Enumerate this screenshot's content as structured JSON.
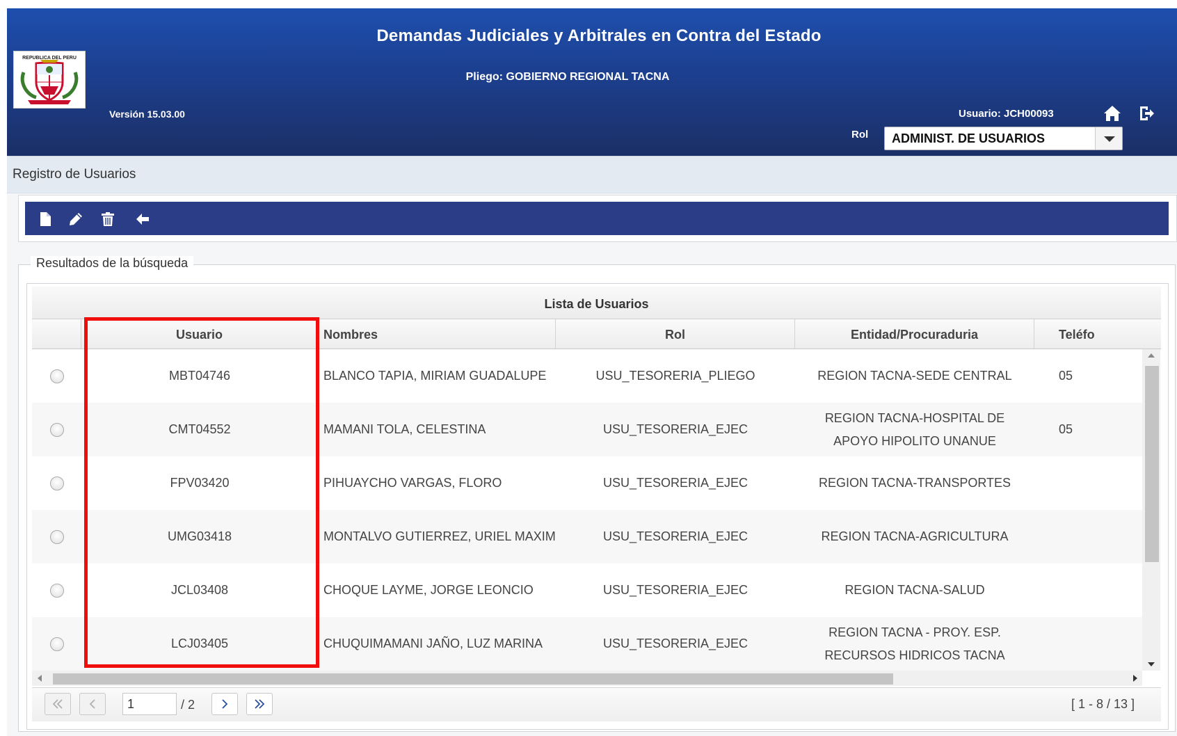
{
  "header": {
    "title": "Demandas Judiciales y Arbitrales en Contra del Estado",
    "pliego": "Pliego: GOBIERNO REGIONAL TACNA",
    "version": "Versión 15.03.00",
    "usuario": "Usuario: JCH00093",
    "rol_label": "Rol",
    "rol_value": "ADMINIST. DE USUARIOS",
    "crest_text": "REPUBLICA DEL PERU",
    "icons": [
      "home-icon",
      "exit-icon"
    ]
  },
  "page": {
    "title": "Registro de Usuarios"
  },
  "toolbar": {
    "icons": [
      "new-document-icon",
      "edit-pencil-icon",
      "delete-trash-icon",
      "back-arrow-icon"
    ]
  },
  "results": {
    "legend": "Resultados de la búsqueda",
    "caption": "Lista de Usuarios",
    "columns": {
      "usuario": "Usuario",
      "nombres": "Nombres",
      "rol": "Rol",
      "entidad": "Entidad/Procuraduria",
      "telefono": "Teléfo"
    },
    "rows": [
      {
        "usuario": "MBT04746",
        "nombres": "BLANCO TAPIA, MIRIAM GUADALUPE",
        "rol": "USU_TESORERIA_PLIEGO",
        "entidad": "REGION TACNA-SEDE CENTRAL",
        "telefono": "05"
      },
      {
        "usuario": "CMT04552",
        "nombres": "MAMANI TOLA, CELESTINA",
        "rol": "USU_TESORERIA_EJEC",
        "entidad": "REGION TACNA-HOSPITAL DE APOYO HIPOLITO UNANUE",
        "telefono": "05"
      },
      {
        "usuario": "FPV03420",
        "nombres": "PIHUAYCHO VARGAS, FLORO",
        "rol": "USU_TESORERIA_EJEC",
        "entidad": "REGION TACNA-TRANSPORTES",
        "telefono": ""
      },
      {
        "usuario": "UMG03418",
        "nombres": "MONTALVO GUTIERREZ, URIEL MAXIMO",
        "rol": "USU_TESORERIA_EJEC",
        "entidad": "REGION TACNA-AGRICULTURA",
        "telefono": ""
      },
      {
        "usuario": "JCL03408",
        "nombres": "CHOQUE LAYME, JORGE LEONCIO",
        "rol": "USU_TESORERIA_EJEC",
        "entidad": "REGION TACNA-SALUD",
        "telefono": ""
      },
      {
        "usuario": "LCJ03405",
        "nombres": "CHUQUIMAMANI JAÑO, LUZ MARINA",
        "rol": "USU_TESORERIA_EJEC",
        "entidad": "REGION TACNA - PROY. ESP. RECURSOS HIDRICOS TACNA",
        "telefono": ""
      }
    ],
    "pager": {
      "current_page": "1",
      "total": "/ 2",
      "range": "[ 1 - 8 / 13 ]",
      "icons": [
        "first-page-icon",
        "prev-page-icon",
        "next-page-icon",
        "last-page-icon"
      ]
    }
  },
  "colors": {
    "header_blue": "#1c3f8e",
    "toolbar_blue": "#2a3d86",
    "highlight_red": "#f20d0d"
  }
}
